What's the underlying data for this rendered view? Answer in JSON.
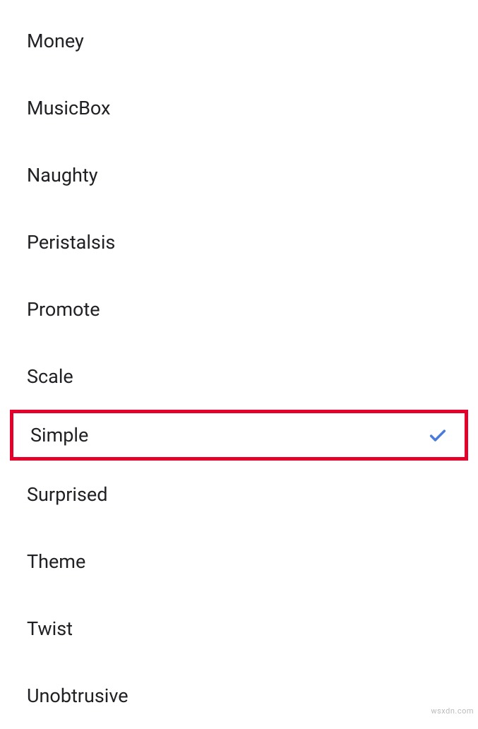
{
  "list": {
    "items": [
      {
        "label": "Money",
        "selected": false,
        "highlighted": false
      },
      {
        "label": "MusicBox",
        "selected": false,
        "highlighted": false
      },
      {
        "label": "Naughty",
        "selected": false,
        "highlighted": false
      },
      {
        "label": "Peristalsis",
        "selected": false,
        "highlighted": false
      },
      {
        "label": "Promote",
        "selected": false,
        "highlighted": false
      },
      {
        "label": "Scale",
        "selected": false,
        "highlighted": false
      },
      {
        "label": "Simple",
        "selected": true,
        "highlighted": true
      },
      {
        "label": "Surprised",
        "selected": false,
        "highlighted": false
      },
      {
        "label": "Theme",
        "selected": false,
        "highlighted": false
      },
      {
        "label": "Twist",
        "selected": false,
        "highlighted": false
      },
      {
        "label": "Unobtrusive",
        "selected": false,
        "highlighted": false
      }
    ]
  },
  "colors": {
    "highlight_border": "#e4002b",
    "check_color": "#4a7bd8"
  },
  "watermark": "wsxdn.com"
}
